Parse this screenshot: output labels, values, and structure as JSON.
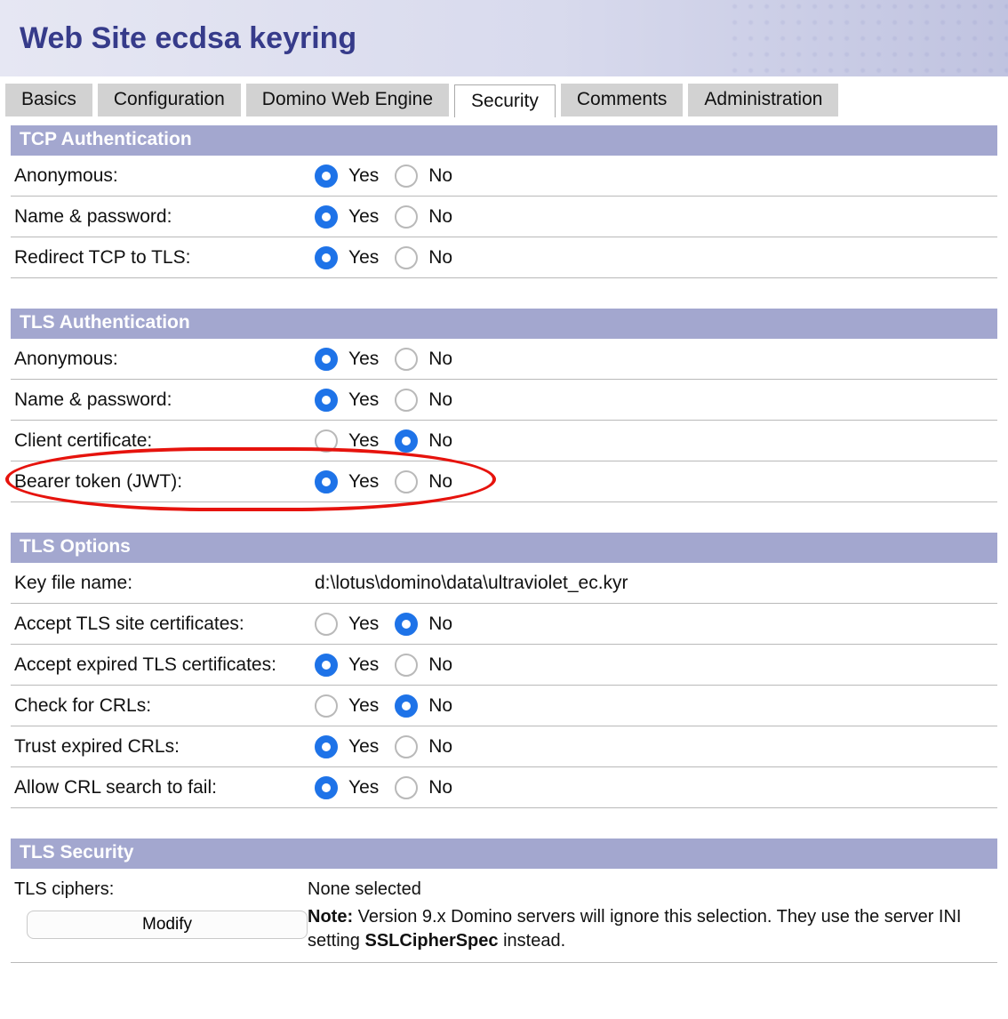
{
  "banner": {
    "title": "Web Site ecdsa keyring"
  },
  "tabs": [
    {
      "label": "Basics",
      "active": false
    },
    {
      "label": "Configuration",
      "active": false
    },
    {
      "label": "Domino Web Engine",
      "active": false
    },
    {
      "label": "Security",
      "active": true
    },
    {
      "label": "Comments",
      "active": false
    },
    {
      "label": "Administration",
      "active": false
    }
  ],
  "options": {
    "yes": "Yes",
    "no": "No"
  },
  "sections": {
    "tcp_auth": {
      "title": "TCP Authentication",
      "rows": [
        {
          "label": "Anonymous:",
          "value": "Yes"
        },
        {
          "label": "Name & password:",
          "value": "Yes"
        },
        {
          "label": "Redirect TCP to TLS:",
          "value": "Yes"
        }
      ]
    },
    "tls_auth": {
      "title": "TLS Authentication",
      "rows": [
        {
          "label": "Anonymous:",
          "value": "Yes"
        },
        {
          "label": "Name & password:",
          "value": "Yes"
        },
        {
          "label": "Client certificate:",
          "value": "No"
        },
        {
          "label": "Bearer token (JWT):",
          "value": "Yes",
          "highlight": true
        }
      ]
    },
    "tls_options": {
      "title": "TLS Options",
      "key_file": {
        "label": "Key file name:",
        "value": "d:\\lotus\\domino\\data\\ultraviolet_ec.kyr"
      },
      "rows": [
        {
          "label": "Accept TLS site certificates:",
          "value": "No"
        },
        {
          "label": "Accept expired TLS certificates:",
          "value": "Yes"
        },
        {
          "label": "Check for CRLs:",
          "value": "No"
        },
        {
          "label": "Trust expired CRLs:",
          "value": "Yes"
        },
        {
          "label": "Allow CRL search to fail:",
          "value": "Yes"
        }
      ]
    },
    "tls_security": {
      "title": "TLS Security",
      "ciphers_label": "TLS ciphers:",
      "ciphers_value": "None selected",
      "modify_label": "Modify",
      "note_prefix": "Note:",
      "note_text_a": " Version 9.x Domino servers will ignore this selection. They use the server INI setting ",
      "note_bold": "SSLCipherSpec",
      "note_text_b": " instead."
    }
  }
}
